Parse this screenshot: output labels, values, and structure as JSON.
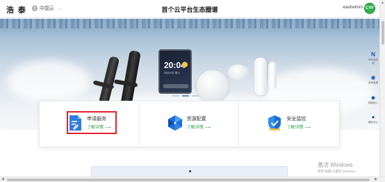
{
  "header": {
    "logo_text": "浩 泰",
    "region_label": "中国云",
    "title": "首个云平台生态圈谱",
    "username": "xiaohelmm",
    "avatar_text": "CYF"
  },
  "hero": {
    "panel_time": "20:04",
    "panel_date": "06月10日 周六",
    "panel_temp": "15°C"
  },
  "services": [
    {
      "name": "申请服务",
      "more": "了解详情 ⟶",
      "icon": "document-edit-icon",
      "color": "#2f7de1"
    },
    {
      "name": "资源配置",
      "more": "了解详情 ⟶",
      "icon": "cube-hexagon-icon",
      "color": "#1e6fd9"
    },
    {
      "name": "安全监控",
      "more": "了解详情 ⟶",
      "icon": "shield-check-icon",
      "color": "#2f8fe8"
    }
  ],
  "sidebar": [
    {
      "icon": "N",
      "label": "AI行业应用"
    },
    {
      "icon": "◉",
      "label": "自动运维"
    },
    {
      "icon": "◆",
      "label": "招商加入"
    },
    {
      "icon": "●",
      "label": "服务中心"
    }
  ],
  "watermark": {
    "line1": "激活 Windows",
    "line2": "转到“设置”以激活 Windows。"
  },
  "colors": {
    "accent_green": "#2ea44f",
    "highlight_red": "#e0202a",
    "brand_blue": "#1e6fd9"
  }
}
